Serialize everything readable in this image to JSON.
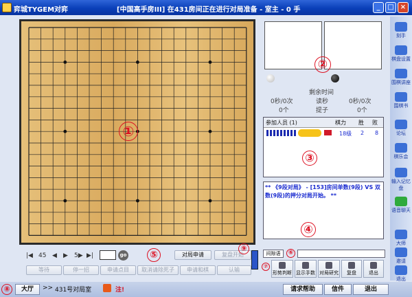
{
  "title": {
    "app": "弈城TYGEM对弈",
    "status": "[中国高手房III]  在431房间正在进行对局准备 - 室主 - 0 手",
    "window_buttons": [
      "_",
      "□",
      "×"
    ]
  },
  "annotations": [
    "①",
    "②",
    "③",
    "④",
    "⑤",
    "⑥",
    "⑦",
    "⑧",
    "⑨"
  ],
  "controls": {
    "nav": [
      "|◀",
      "45",
      "◀",
      "▶",
      "5▶",
      "▶|"
    ],
    "go_label": "go",
    "apply_match": "对局申请",
    "resume_match": "复盘开始",
    "row2": [
      "等待",
      "停一招",
      "申请点目",
      "取消请除死子",
      "申请和棋",
      "认输"
    ]
  },
  "right_panel": {
    "remaining_time": "剩余时间",
    "byoyomi": "读秒",
    "captures": "提子",
    "left_time": "0秒/0次",
    "right_time": "0秒/0次",
    "left_caps": "0个",
    "right_caps": "0个",
    "players_header": [
      "参加人员 (1)",
      "棋力",
      "胜",
      "败"
    ],
    "player_rank": "18级",
    "player_wins": "2",
    "player_losses": "8",
    "chat": "** 《9段对局》 - [153]房间单数(9段) VS 双数(9段)的押分对局开始。 **"
  },
  "chat_input": {
    "label": "间隙语"
  },
  "tools": [
    "形势判断",
    "显示手数",
    "对局研究",
    "复盘",
    "退出"
  ],
  "sidebar": [
    "刻手",
    "棋盘设置",
    "围棋讲座",
    "围棋书",
    "论坛",
    "棋乐会",
    "输入记忆盘",
    "语音聊天",
    "大师",
    "邀请",
    "退出"
  ],
  "bottom": {
    "hall": "大厅",
    "room": "431号对局室",
    "notice": "注!",
    "help": "请求帮助",
    "mail": "信件",
    "exit": "退出"
  },
  "colors": {
    "accent_red": "#d11a2a",
    "title_blue": "#0a3fb8",
    "board": "#dfb56a"
  }
}
